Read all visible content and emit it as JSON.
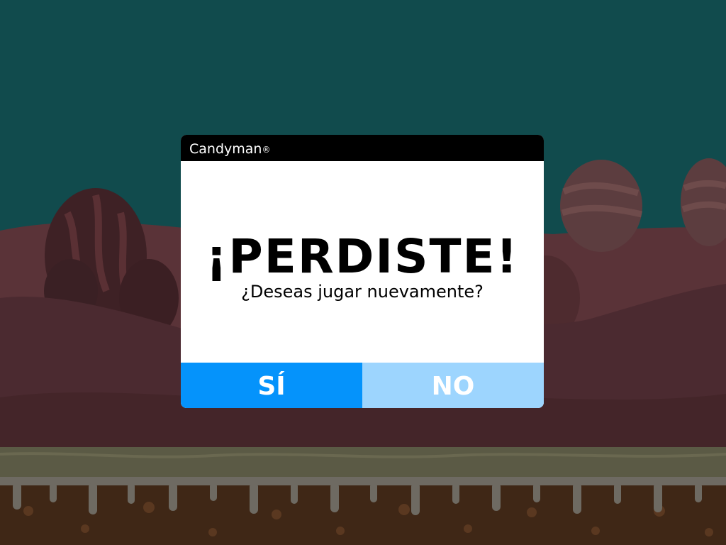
{
  "dialog": {
    "app_name": "Candyman",
    "trademark": "®",
    "headline": "¡PERDISTE!",
    "subtitle": "¿Deseas jugar nuevamente?",
    "yes_label": "SÍ",
    "no_label": "NO"
  },
  "colors": {
    "sky": "#114b4d",
    "hills_dark": "#4b2a30",
    "titlebar": "#000000",
    "yes_button": "#0593fb",
    "no_button": "#9dd5fe"
  }
}
